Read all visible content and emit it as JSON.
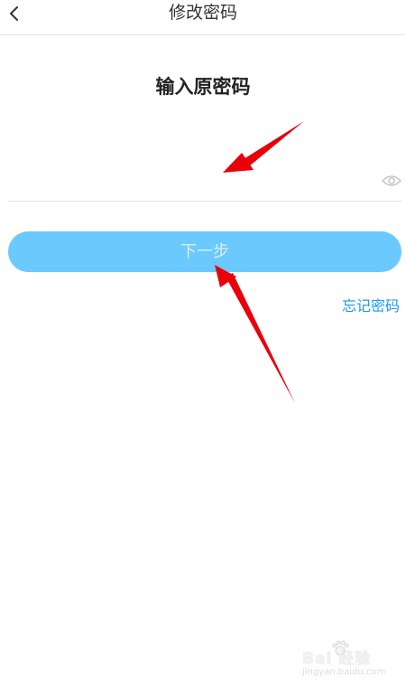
{
  "nav": {
    "title": "修改密码",
    "back_icon": "chevron-left-icon"
  },
  "heading": "输入原密码",
  "password_field": {
    "value": "",
    "visibility_icon": "eye-icon"
  },
  "next_button": {
    "label": "下一步",
    "state": "disabled"
  },
  "forgot_link": "忘记密码",
  "watermark": {
    "brand": "Bai 经验",
    "site": "jingyan.baidu.com"
  },
  "colors": {
    "button_bg": "#6cc9fd",
    "button_text": "#d6f0ff",
    "link": "#1a9be8",
    "annotation_arrow": "#e8000b"
  }
}
